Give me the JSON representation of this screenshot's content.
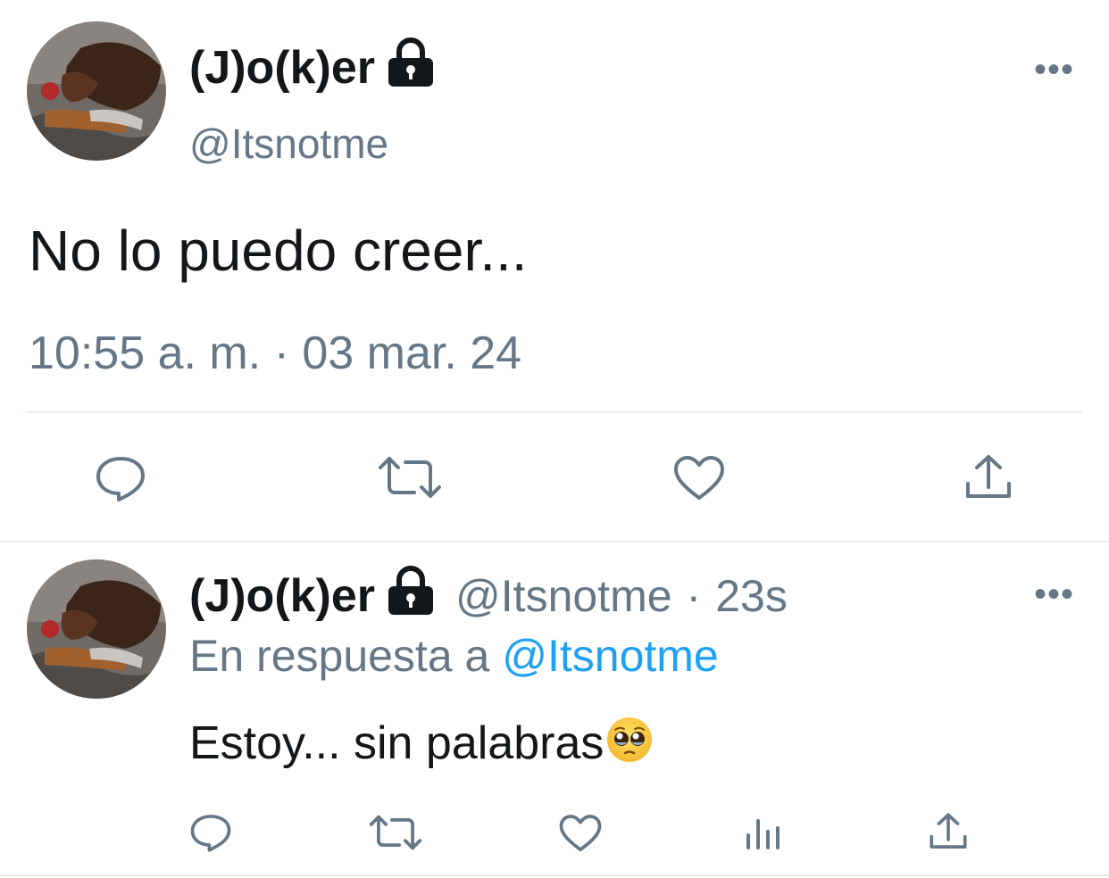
{
  "main_tweet": {
    "author_name": "(J)o(k)er",
    "handle": "@Itsnotme",
    "text": "No lo puedo creer...",
    "timestamp": "10:55 a. m. · 03 mar. 24",
    "more_label": "•••",
    "actions": [
      "reply-icon",
      "retweet-icon",
      "like-icon",
      "share-icon"
    ]
  },
  "reply_tweet": {
    "author_name": "(J)o(k)er",
    "handle": "@Itsnotme",
    "separator": "·",
    "time_ago": "23s",
    "replying_prefix": "En respuesta a",
    "replying_to": "@Itsnotme",
    "text": "Estoy... sin palabras",
    "emoji": "pleading-face",
    "more_label": "•••",
    "actions": [
      "reply-icon",
      "retweet-icon",
      "like-icon",
      "analytics-icon",
      "share-icon"
    ]
  },
  "colors": {
    "text": "#14171a",
    "secondary": "#657786",
    "link": "#1da1f2",
    "divider": "#e6ecf0"
  }
}
